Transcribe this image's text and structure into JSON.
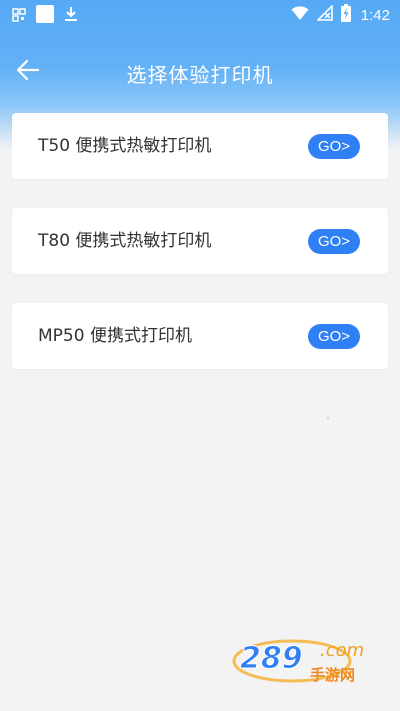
{
  "status_bar": {
    "time": "1:42",
    "icons": [
      "qr-grid-icon",
      "white-square-icon",
      "download-icon",
      "wifi-icon",
      "no-signal-icon",
      "battery-charging-icon"
    ]
  },
  "app_bar": {
    "back_icon": "arrow-left-icon",
    "title": "选择体验打印机"
  },
  "printers": [
    {
      "label": "T50 便携式热敏打印机",
      "action": "GO>"
    },
    {
      "label": "T80 便携式热敏打印机",
      "action": "GO>"
    },
    {
      "label": "MP50 便携式打印机",
      "action": "GO>"
    }
  ],
  "watermark": {
    "logo": "289.com",
    "subtitle": "手游网"
  },
  "colors": {
    "header_blue": "#55a9f5",
    "button_blue": "#2f7ff5",
    "background": "#f3f3f4",
    "text": "#333333"
  }
}
